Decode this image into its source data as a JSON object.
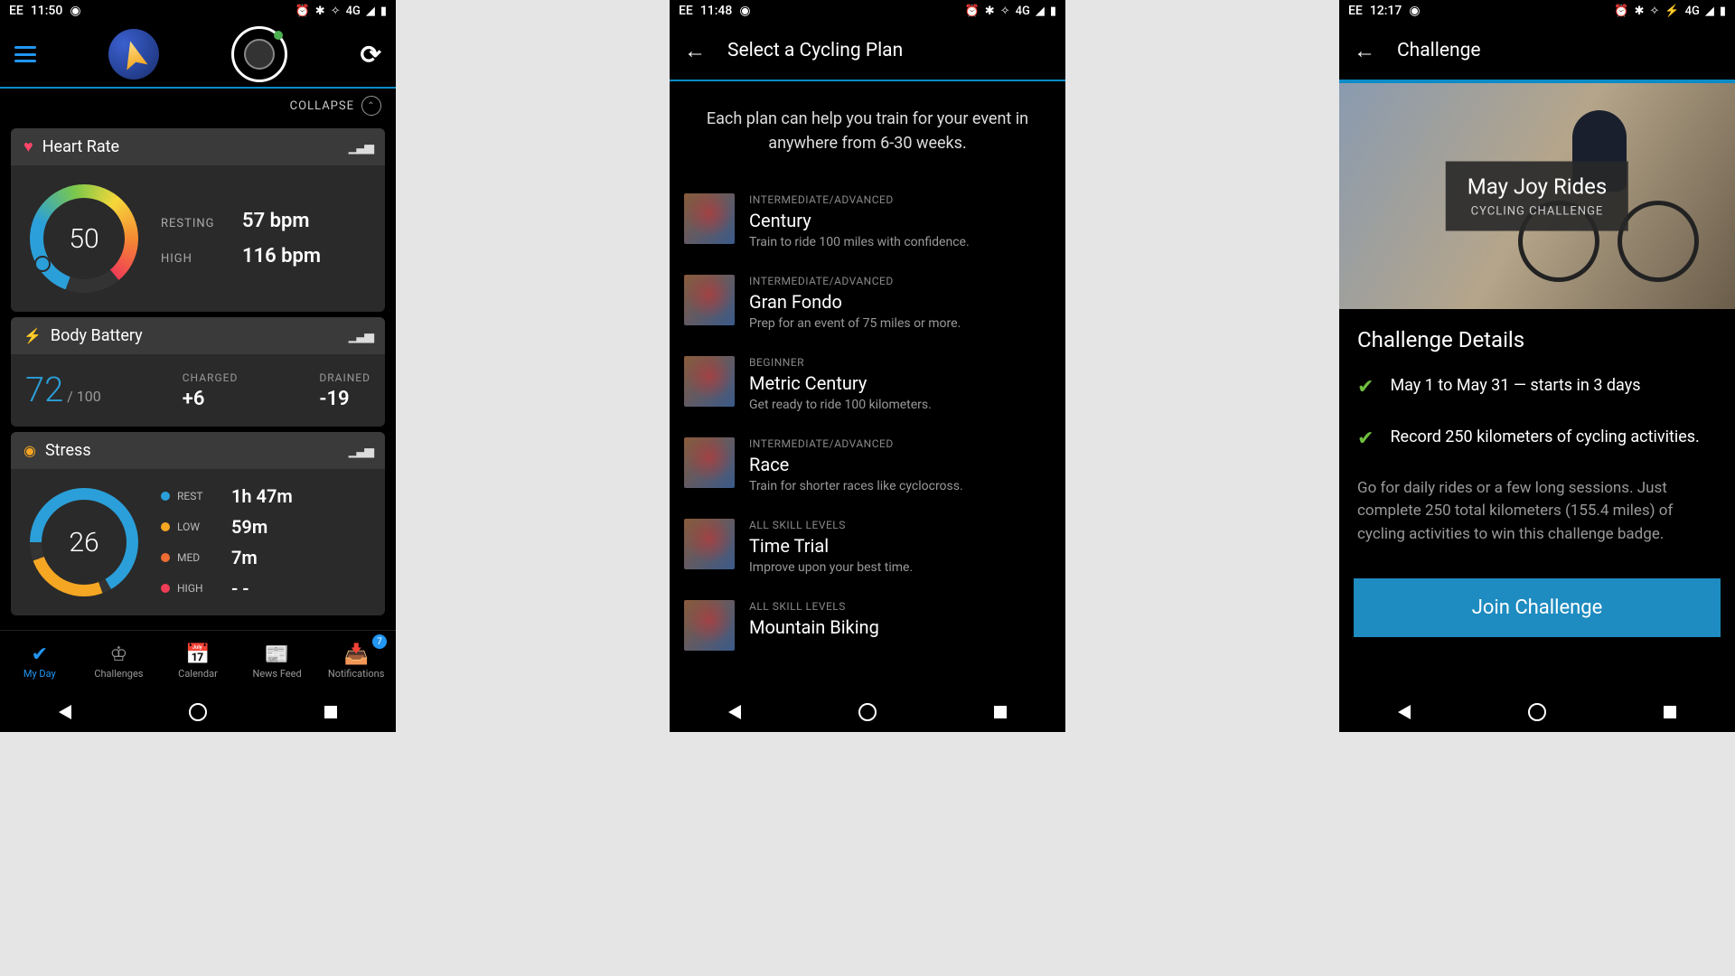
{
  "screen1": {
    "status": {
      "carrier": "EE",
      "time": "11:50",
      "signal": "4G"
    },
    "collapse": "COLLAPSE",
    "heartRate": {
      "title": "Heart Rate",
      "value": "50",
      "resting_label": "RESTING",
      "resting_val": "57 bpm",
      "high_label": "HIGH",
      "high_val": "116 bpm"
    },
    "bodyBattery": {
      "title": "Body Battery",
      "value": "72",
      "max": "/ 100",
      "charged_label": "CHARGED",
      "charged_val": "+6",
      "drained_label": "DRAINED",
      "drained_val": "-19"
    },
    "stress": {
      "title": "Stress",
      "value": "26",
      "legend": [
        {
          "color": "#2b9fd9",
          "label": "REST",
          "val": "1h 47m"
        },
        {
          "color": "#f5a623",
          "label": "LOW",
          "val": "59m"
        },
        {
          "color": "#ef6c33",
          "label": "MED",
          "val": "7m"
        },
        {
          "color": "#ef3d55",
          "label": "HIGH",
          "val": "- -"
        }
      ]
    },
    "nav": [
      {
        "label": "My Day",
        "active": true
      },
      {
        "label": "Challenges"
      },
      {
        "label": "Calendar"
      },
      {
        "label": "News Feed"
      },
      {
        "label": "Notifications",
        "badge": "7"
      }
    ]
  },
  "screen2": {
    "status": {
      "carrier": "EE",
      "time": "11:48",
      "signal": "4G"
    },
    "title": "Select a Cycling Plan",
    "subtitle": "Each plan can help you train for your event in anywhere from 6-30 weeks.",
    "plans": [
      {
        "level": "INTERMEDIATE/ADVANCED",
        "name": "Century",
        "desc": "Train to ride 100 miles with confidence."
      },
      {
        "level": "INTERMEDIATE/ADVANCED",
        "name": "Gran Fondo",
        "desc": "Prep for an event of 75 miles or more."
      },
      {
        "level": "BEGINNER",
        "name": "Metric Century",
        "desc": "Get ready to ride 100 kilometers."
      },
      {
        "level": "INTERMEDIATE/ADVANCED",
        "name": "Race",
        "desc": "Train for shorter races like cyclocross."
      },
      {
        "level": "ALL SKILL LEVELS",
        "name": "Time Trial",
        "desc": "Improve upon your best time."
      },
      {
        "level": "ALL SKILL LEVELS",
        "name": "Mountain Biking",
        "desc": ""
      }
    ]
  },
  "screen3": {
    "status": {
      "carrier": "EE",
      "time": "12:17",
      "signal": "4G"
    },
    "title": "Challenge",
    "hero_title": "May Joy Rides",
    "hero_sub": "CYCLING CHALLENGE",
    "details_title": "Challenge Details",
    "checks": [
      "May 1 to May 31 — starts in 3 days",
      "Record 250 kilometers of cycling activities."
    ],
    "desc": "Go for daily rides or a few long sessions. Just complete 250 total kilometers (155.4 miles) of cycling activities to win this challenge badge.",
    "join": "Join Challenge"
  }
}
